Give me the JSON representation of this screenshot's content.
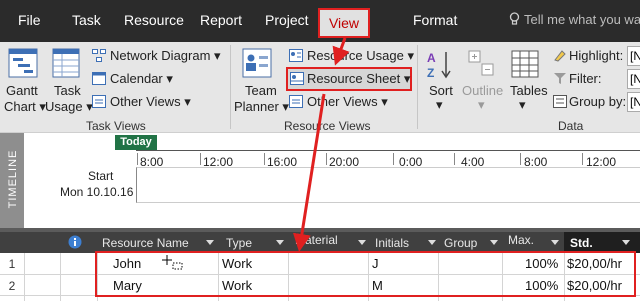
{
  "menu": {
    "tabs": [
      "File",
      "Task",
      "Resource",
      "Report",
      "Project"
    ],
    "view_tab": "View",
    "format_tab": "Format",
    "tell_me_placeholder": "Tell me what you wan"
  },
  "ribbon": {
    "gantt_chart": {
      "line1": "Gantt",
      "line2": "Chart"
    },
    "task_usage": {
      "line1": "Task",
      "line2": "Usage"
    },
    "network_diagram": "Network Diagram",
    "calendar": "Calendar",
    "other_views_task": "Other Views",
    "task_views_group": "Task Views",
    "team_planner": {
      "line1": "Team",
      "line2": "Planner"
    },
    "resource_usage": "Resource Usage",
    "resource_sheet": "Resource Sheet",
    "other_views_resource": "Other Views",
    "resource_views_group": "Resource Views",
    "sort": "Sort",
    "outline": "Outline",
    "tables": "Tables",
    "highlight": "Highlight:",
    "filter": "Filter:",
    "group_by": "Group by:",
    "data_group": "Data",
    "combo_value": "[N"
  },
  "timeline": {
    "side_label": "TIMELINE",
    "today": "Today",
    "start_label": "Start",
    "start_date": "Mon 10.10.16",
    "ticks": [
      "8:00",
      "12:00",
      "16:00",
      "20:00",
      "0:00",
      "4:00",
      "8:00",
      "12:00"
    ]
  },
  "grid": {
    "columns": [
      "Resource Name",
      "Type",
      "Material",
      "Initials",
      "Group",
      "Max.",
      "Std."
    ],
    "rows": [
      {
        "num": "1",
        "name": "John",
        "type": "Work",
        "material": "",
        "initials": "J",
        "group": "",
        "max": "100%",
        "std": "$20,00/hr"
      },
      {
        "num": "2",
        "name": "Mary",
        "type": "Work",
        "material": "",
        "initials": "M",
        "group": "",
        "max": "100%",
        "std": "$20,00/hr"
      }
    ]
  },
  "colors": {
    "accent_red": "#e02020",
    "today_green": "#217346",
    "menubar": "#2b2b2b"
  }
}
